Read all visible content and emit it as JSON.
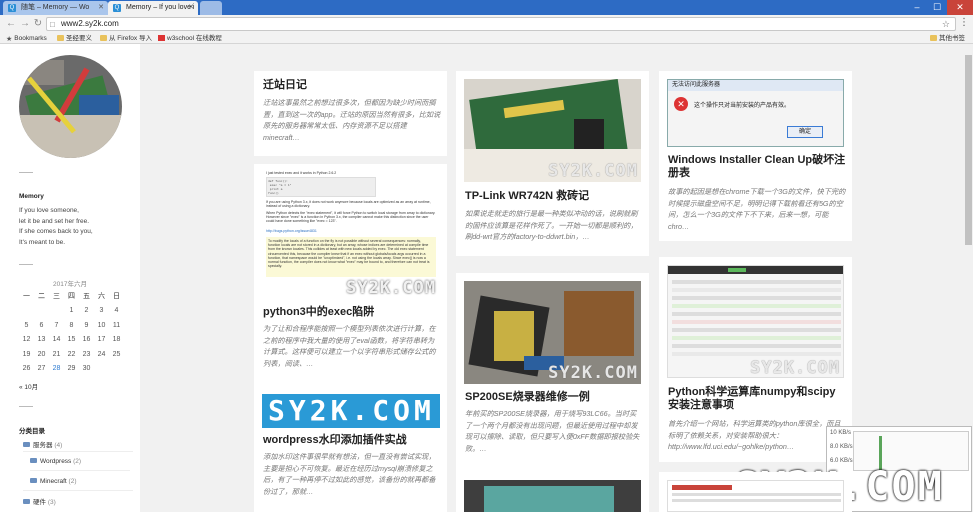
{
  "browser": {
    "tabs": [
      {
        "title": "随笔 – Memory — Wo"
      },
      {
        "title": "Memory – If you love i"
      }
    ],
    "url": "www2.sy2k.com",
    "bookmarks": [
      {
        "label": "Bookmarks",
        "icon": "star-icon"
      },
      {
        "label": "圣经要义",
        "icon": "folder-icon"
      },
      {
        "label": "从 Firefox 导入",
        "icon": "folder-icon"
      },
      {
        "label": "w3school 在线教程",
        "icon": "w3school-icon"
      }
    ],
    "other_bookmarks": "其他书签"
  },
  "sidebar": {
    "widget_title": "Memory",
    "poem": [
      "If you love someone,",
      "let it be and set her free.",
      "If she comes back to you,",
      "It's meant to be."
    ],
    "calendar": {
      "caption": "2017年六月",
      "headers": [
        "一",
        "二",
        "三",
        "四",
        "五",
        "六",
        "日"
      ],
      "weeks": [
        [
          "",
          "",
          "",
          "1",
          "2",
          "3",
          "4"
        ],
        [
          "5",
          "6",
          "7",
          "8",
          "9",
          "10",
          "11"
        ],
        [
          "12",
          "13",
          "14",
          "15",
          "16",
          "17",
          "18"
        ],
        [
          "19",
          "20",
          "21",
          "22",
          "23",
          "24",
          "25"
        ],
        [
          "26",
          "27",
          "28",
          "29",
          "30",
          "",
          ""
        ]
      ],
      "today": "28",
      "prev": "« 10月"
    },
    "categories_title": "分类目录",
    "categories": [
      {
        "name": "服务器",
        "count": "(4)"
      },
      {
        "name": "Wordpress",
        "count": "(2)"
      },
      {
        "name": "Minecraft",
        "count": "(2)"
      },
      {
        "name": "硬件",
        "count": "(3)"
      }
    ]
  },
  "posts": [
    {
      "title": "迁站日记",
      "excerpt": "迁站这事虽然之前想过很多次，但都因为缺少时间而搁置，直到这一次的app。迁站的原因当然有很多，比如说原先的服务器常常太低、内存资源不足以搭建minecraft…"
    },
    {
      "title": "python3中的exec陷阱",
      "excerpt": "为了让和合程序能按照一个模型列表依次进行计算，在之前的程序中我大量的使用了eval函数，将字符串转为计算式。这样便可以建立一个以字符串形式储存公式的列表，阅读、…"
    },
    {
      "title": "wordpress水印添加插件实战",
      "excerpt": "添加水印这件事很早就有想法，但一直没有尝试实现，主要是担心不可恢复。最近在经历过mysql崩溃修复之后，有了一种再停不过如此的感觉，该备份的就再都备份过了，那就…"
    },
    {
      "title": "TP-Link WR742N 救砖记",
      "excerpt": "如果说走就走的旅行是最一种类似冲动的话，说刷就刷的固件应该算是花样作死了。一开始一切都是顺利的，刷dd-wrt官方的factory-to-ddwrt.bin，…"
    },
    {
      "title": "SP200SE烧录器维修一例",
      "excerpt": "年前买的SP200SE烧录器，用于烧写93LC66。当时买了一个两个月都没有出现问题，但最近使用过程中却发现可以擦除、读取，但只要写入便0xFF数据即报校验失败。…"
    },
    {
      "title": "Windows Installer Clean Up破坏注册表",
      "excerpt": "故事的起因是想在chrome下载一个3G的文件，快下完的时候提示磁盘空间不足，明明记得下载前看还有5G的空间，怎么一个3G的文件下不下来，后来一想，可能chro…"
    },
    {
      "title": "Python科学运算库numpy和scipy安装注意事项",
      "excerpt": "首先介绍一个网站，科学运算类的python库很全，而且标明了依赖关系，对安装帮助很大：http://www.lfd.uci.edu/~gohlke/python…"
    }
  ],
  "thumbnails": {
    "python_doc_lines": [
      "I just tested exec and it works in Python 2.6.2",
      "If you are using Python 3.x, it does not work anymore because locals are optimized as an array at runtime, instead of using a dictionary.",
      "When Python detects the \"exec statement\", it will force Python to switch local storage from array to dictionary. However since \"exec\" is a function in Python 3.x, the compiler cannot make this distinction since the user could have done something like \"exec = 123\".",
      "http://bugs.python.org/issue4831",
      "To modify the locals of a function on the fly is not possible without several consequences: normally, function locals are not stored in a dictionary, but an array, whose indices are determined at compile time from the known locales. This collides at least with new locals added by exec. The old exec statement circumvented this, because the compiler knew that if an exec without globals/locals args occurred in a function, that namespace would be \"unoptimized\", i.e. not using the locals array. Since exec() is now a normal function, the compiler does not know what \"exec\" may be bound to, and therefore can not treat is specially."
    ],
    "watermark": "SY2K.COM",
    "dialog_title": "无法访问此服务器",
    "dialog_text": "这个操作只对当前安装的产品有效。",
    "dialog_button": "确定",
    "net_labels": [
      "10 KB/s",
      "8.0 KB/s",
      "6.0 KB/s"
    ]
  },
  "colors": {
    "accent": "#2b7ad1",
    "tabbar": "#2d6bc4",
    "watermark_blue": "#2a9ad6"
  }
}
